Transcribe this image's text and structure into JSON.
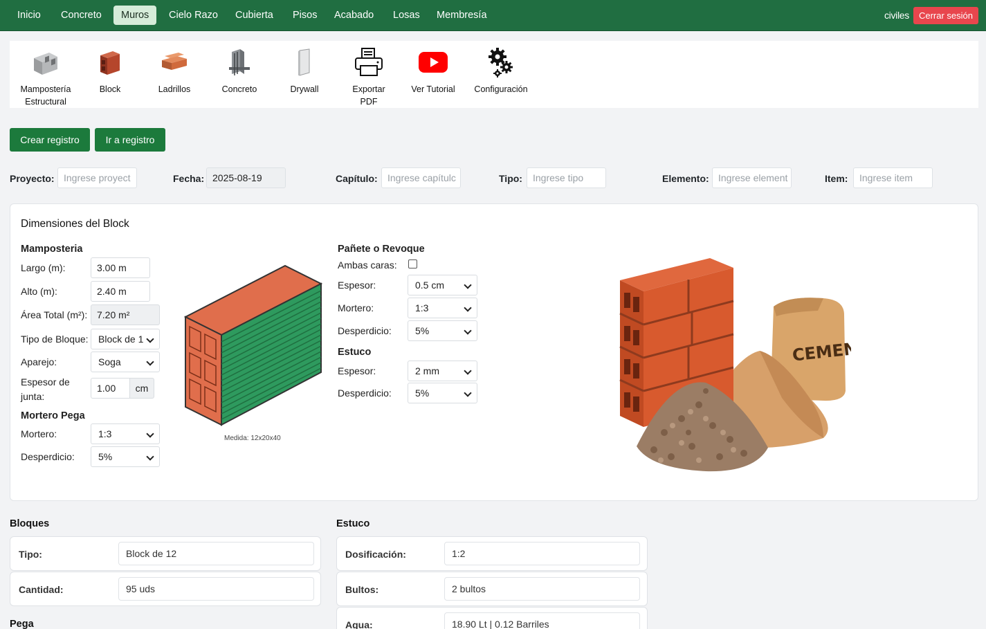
{
  "nav": {
    "items": [
      "Inicio",
      "Concreto",
      "Muros",
      "Cielo Razo",
      "Cubierta",
      "Pisos",
      "Acabado",
      "Losas",
      "Membresía"
    ],
    "active": "Muros",
    "user": "civiles",
    "logout": "Cerrar sesión"
  },
  "toolbar": {
    "items": [
      {
        "label": "Mampostería Estructural",
        "icon": "concrete-block-icon"
      },
      {
        "label": "Block",
        "icon": "red-block-icon"
      },
      {
        "label": "Ladrillos",
        "icon": "bricks-icon"
      },
      {
        "label": "Concreto",
        "icon": "concrete-wall-icon"
      },
      {
        "label": "Drywall",
        "icon": "drywall-panel-icon"
      },
      {
        "label": "Exportar PDF",
        "icon": "printer-icon"
      },
      {
        "label": "Ver Tutorial",
        "icon": "youtube-icon"
      },
      {
        "label": "Configuración",
        "icon": "gears-icon"
      }
    ]
  },
  "actions": {
    "create": "Crear registro",
    "goto": "Ir a registro"
  },
  "form": {
    "proyecto": {
      "label": "Proyecto:",
      "placeholder": "Ingrese proyect"
    },
    "fecha": {
      "label": "Fecha:",
      "value": "2025-08-19"
    },
    "capitulo": {
      "label": "Capítulo:",
      "placeholder": "Ingrese capítulc"
    },
    "tipo": {
      "label": "Tipo:",
      "placeholder": "Ingrese tipo"
    },
    "elemento": {
      "label": "Elemento:",
      "placeholder": "Ingrese element"
    },
    "item": {
      "label": "Item:",
      "placeholder": "Ingrese item"
    }
  },
  "card": {
    "title": "Dimensiones del Block",
    "mamposteria": {
      "title": "Mamposteria",
      "largo_label": "Largo (m):",
      "largo": "3.00 m",
      "alto_label": "Alto (m):",
      "alto": "2.40 m",
      "area_label": "Área Total (m²):",
      "area": "7.20 m²",
      "tipo_label": "Tipo de Bloque:",
      "tipo": "Block de 1",
      "aparejo_label": "Aparejo:",
      "aparejo": "Soga",
      "junta_label1": "Espesor de",
      "junta_label2": "junta:",
      "junta": "1.00",
      "junta_unit": "cm"
    },
    "mortero_pega": {
      "title": "Mortero Pega",
      "mortero_label": "Mortero:",
      "mortero": "1:3",
      "desperdicio_label": "Desperdicio:",
      "desperdicio": "5%"
    },
    "block_caption": "Medida: 12x20x40",
    "panete": {
      "title": "Pañete o Revoque",
      "ambas_label": "Ambas caras:",
      "espesor_label": "Espesor:",
      "espesor": "0.5 cm",
      "mortero_label": "Mortero:",
      "mortero": "1:3",
      "desperdicio_label": "Desperdicio:",
      "desperdicio": "5%"
    },
    "estuco": {
      "title": "Estuco",
      "espesor_label": "Espesor:",
      "espesor": "2 mm",
      "desperdicio_label": "Desperdicio:",
      "desperdicio": "5%"
    },
    "cement_text": "CEMENT"
  },
  "results": {
    "bloques": {
      "title": "Bloques",
      "rows": [
        {
          "label": "Tipo:",
          "value": "Block de 12"
        },
        {
          "label": "Cantidad:",
          "value": "95 uds"
        }
      ]
    },
    "pega": {
      "title": "Pega"
    },
    "estuco": {
      "title": "Estuco",
      "rows": [
        {
          "label": "Dosificación:",
          "value": "1:2"
        },
        {
          "label": "Bultos:",
          "value": "2 bultos"
        },
        {
          "label": "Agua:",
          "value": "18.90 Lt | 0.12 Barriles"
        }
      ]
    }
  }
}
